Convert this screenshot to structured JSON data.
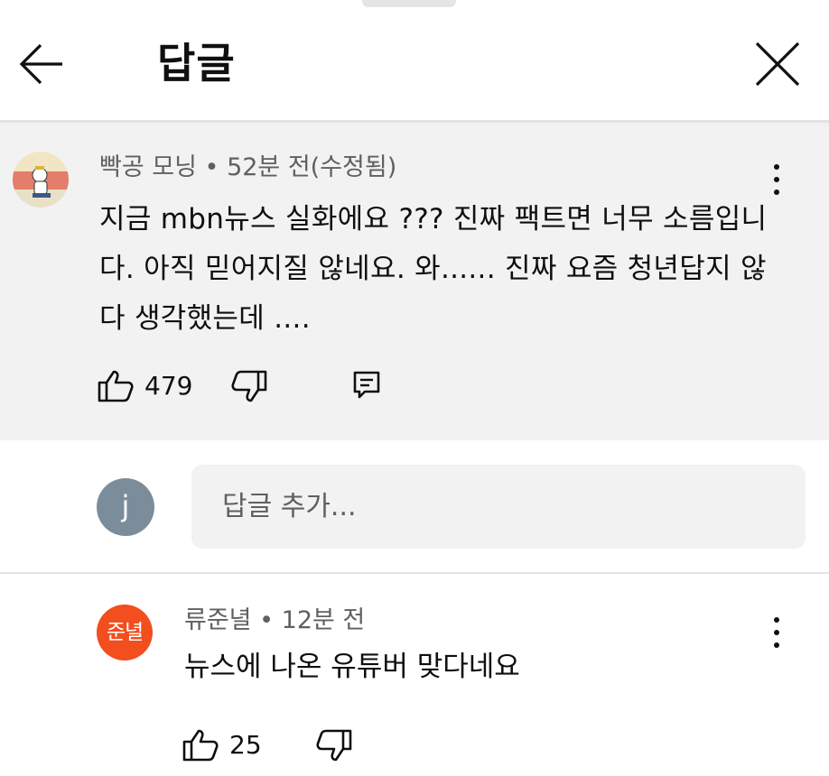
{
  "header": {
    "title": "답글"
  },
  "parent_comment": {
    "author": "빡공 모닝",
    "time": "52분 전(수정됨)",
    "text": "지금 mbn뉴스 실화에요 ??? 진짜 팩트면 너무 소름입니다. 아직 믿어지질 않네요. 와...... 진짜 요즘 청년답지 않다 생각했는데 ....",
    "likes": "479"
  },
  "reply_box": {
    "avatar_initial": "j",
    "placeholder": "답글 추가..."
  },
  "replies": [
    {
      "author": "류준녈",
      "avatar_text": "준녈",
      "time": "12분 전",
      "text": "뉴스에 나온 유튜버 맞다네요",
      "likes": "25"
    }
  ],
  "colors": {
    "parent_bg": "#f2f2f2",
    "reply_avatar": "#f24e1e",
    "my_avatar": "#7b8d9a",
    "secondary_text": "#606060"
  }
}
